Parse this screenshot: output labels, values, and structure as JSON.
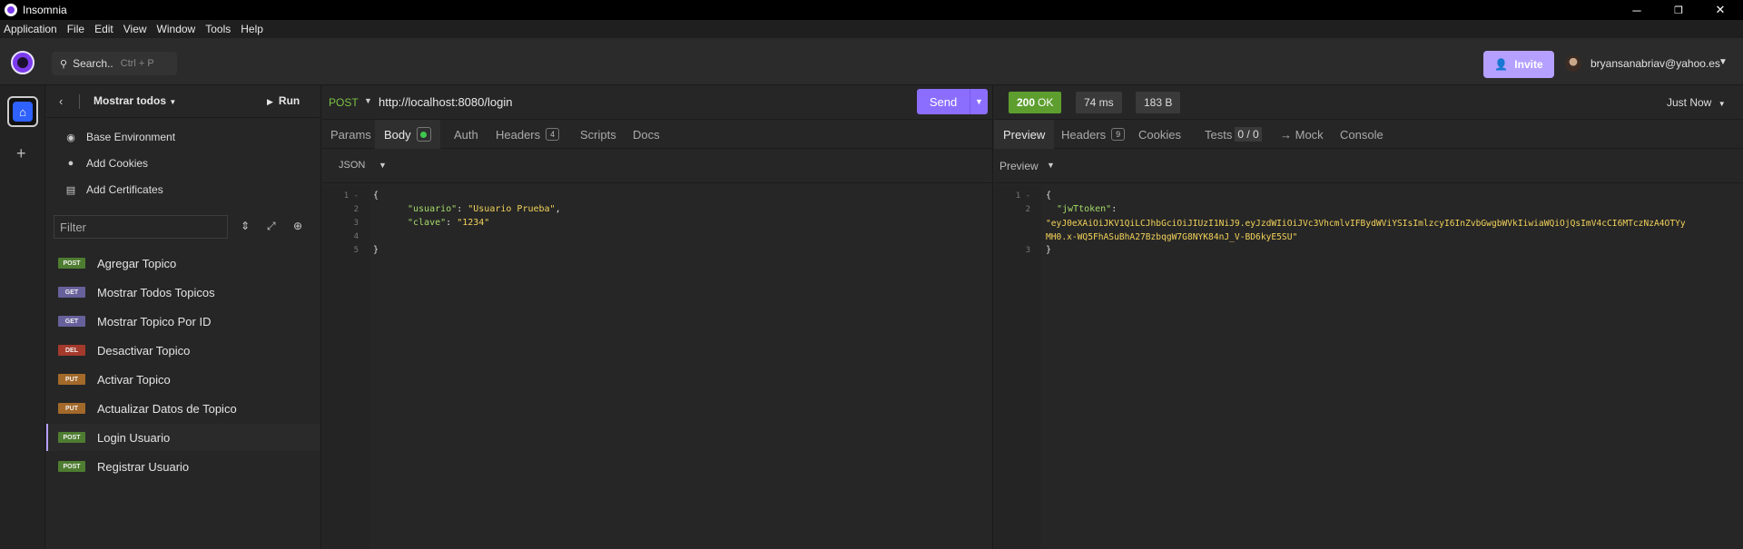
{
  "app": {
    "title": "Insomnia"
  },
  "window_controls": {
    "minimize": "─",
    "maximize": "❐",
    "close": "✕"
  },
  "menu": [
    "Application",
    "File",
    "Edit",
    "View",
    "Window",
    "Tools",
    "Help"
  ],
  "header": {
    "search_label": "Search..",
    "search_shortcut": "Ctrl + P",
    "invite_label": "Invite",
    "user_email": "bryansanabriav@yahoo.es"
  },
  "sidebar": {
    "project_name": "Mostrar todos",
    "run_label": "Run",
    "links": [
      {
        "label": "Base Environment",
        "icon": "globe-icon"
      },
      {
        "label": "Add Cookies",
        "icon": "cookie-icon"
      },
      {
        "label": "Add Certificates",
        "icon": "certificate-icon"
      }
    ],
    "filter_placeholder": "Filter",
    "requests": [
      {
        "method": "POST",
        "name": "Agregar Topico"
      },
      {
        "method": "GET",
        "name": "Mostrar Todos Topicos"
      },
      {
        "method": "GET",
        "name": "Mostrar Topico Por ID"
      },
      {
        "method": "DEL",
        "name": "Desactivar Topico"
      },
      {
        "method": "PUT",
        "name": "Activar Topico"
      },
      {
        "method": "PUT",
        "name": "Actualizar Datos de Topico"
      },
      {
        "method": "POST",
        "name": "Login Usuario",
        "active": true
      },
      {
        "method": "POST",
        "name": "Registrar Usuario"
      }
    ]
  },
  "request": {
    "method": "POST",
    "url": "http://localhost:8080/login",
    "send_label": "Send",
    "tabs": {
      "params": "Params",
      "body": "Body",
      "auth": "Auth",
      "headers": "Headers",
      "headers_count": "4",
      "scripts": "Scripts",
      "docs": "Docs"
    },
    "body_type": "JSON",
    "body_lines": [
      {
        "n": "1",
        "fold": "-",
        "text": "{"
      },
      {
        "n": "2",
        "key": "\"usuario\"",
        "value": "\"Usuario Prueba\"",
        "trail": ","
      },
      {
        "n": "3",
        "key": "\"clave\"",
        "value": "\"1234\"",
        "trail": ""
      },
      {
        "n": "4",
        "text": ""
      },
      {
        "n": "5",
        "text": "}"
      }
    ]
  },
  "response": {
    "status_code": "200",
    "status_text": "OK",
    "time": "74 ms",
    "size": "183 B",
    "timestamp": "Just Now",
    "tabs": {
      "preview": "Preview",
      "headers": "Headers",
      "headers_count": "9",
      "cookies": "Cookies",
      "tests": "Tests",
      "tests_count": "0 / 0",
      "mock": "→ Mock",
      "console": "Console"
    },
    "preview_mode": "Preview",
    "lines": [
      {
        "n": "1",
        "text": "{"
      },
      {
        "n": "2",
        "key": "\"jwTtoken\"",
        "colon": ":"
      },
      {
        "n": "",
        "value": "\"eyJ0eXAiOiJKV1QiLCJhbGciOiJIUzI1NiJ9.eyJzdWIiOiJVc3VhcmlvIFBydWViYSIsImlzcyI6InZvbGwgbWVkIiwiaWQiOjQsImV4cCI6MTczNzA4OTYy"
      },
      {
        "n": "",
        "value": "MH0.x-WQ5FhASuBhA27BzbqgW7G8NYK84nJ_V-BD6kyE5SU\""
      },
      {
        "n": "3",
        "text": "}"
      }
    ]
  },
  "colors": {
    "accent": "#8c6eff",
    "post": "#4e7d31",
    "get": "#66619b",
    "delete": "#a43a2c",
    "put": "#a3692a",
    "status_ok": "#5d9e2e"
  }
}
